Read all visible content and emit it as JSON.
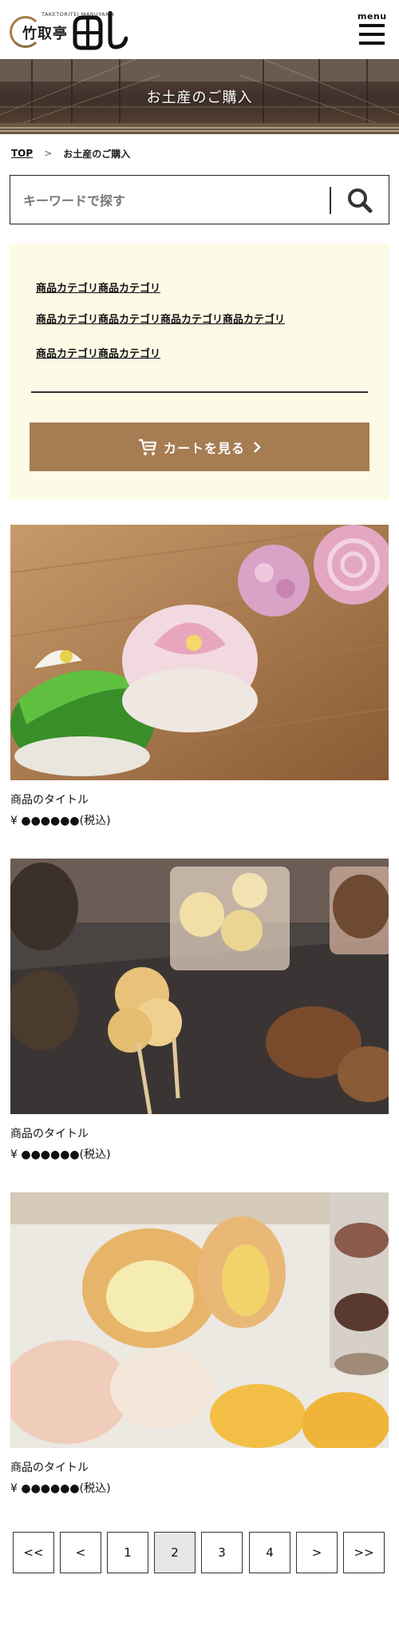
{
  "header": {
    "logo_sub": "TAKETORITEI  MARUYAMA",
    "logo_main": "竹取亭",
    "menu_label": "menu"
  },
  "hero": {
    "title": "お土産のご購入"
  },
  "breadcrumb": {
    "top_label": "TOP",
    "separator": ">",
    "current": "お土産のご購入"
  },
  "search": {
    "placeholder": "キーワードで探す"
  },
  "categories": {
    "links": [
      "商品カテゴリ商品カテゴリ",
      "商品カテゴリ商品カテゴリ商品カテゴリ商品カテゴリ",
      "商品カテゴリ商品カテゴリ"
    ],
    "cart_label": "カートを見る"
  },
  "products": [
    {
      "title": "商品のタイトル",
      "price": "¥ ●●●●●●(税込)",
      "image": "wagashi-namagashi"
    },
    {
      "title": "商品のタイトル",
      "price": "¥ ●●●●●●(税込)",
      "image": "dango-and-sweets"
    },
    {
      "title": "商品のタイトル",
      "price": "¥ ●●●●●●(税込)",
      "image": "manju-and-buns"
    }
  ],
  "pagination": {
    "first": "<<",
    "prev": "<",
    "pages": [
      "1",
      "2",
      "3",
      "4"
    ],
    "current": "2",
    "next": ">",
    "last": ">>"
  },
  "colors": {
    "accent": "#a67c52",
    "category_bg": "#fdfbe6",
    "active_page_bg": "#e6e6e6"
  }
}
